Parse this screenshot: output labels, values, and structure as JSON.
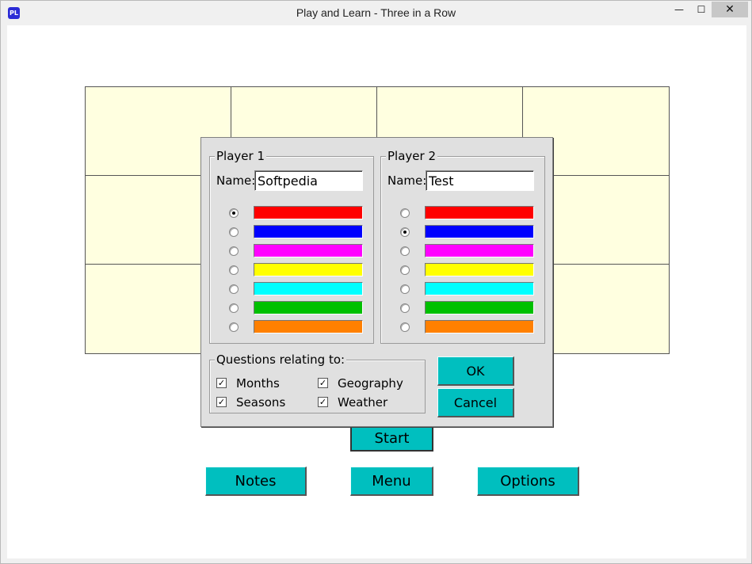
{
  "window": {
    "title": "Play and Learn - Three in a Row",
    "icon_text": "PL",
    "minimize_glyph": "—",
    "maximize_glyph": "☐",
    "close_glyph": "✕"
  },
  "buttons": {
    "start": "Start",
    "notes": "Notes",
    "menu": "Menu",
    "options": "Options"
  },
  "dialog": {
    "player1": {
      "label": "Player 1",
      "name_label": "Name:",
      "name_value": "Softpedia",
      "selected_color_index": 0
    },
    "player2": {
      "label": "Player 2",
      "name_label": "Name:",
      "name_value": "Test",
      "selected_color_index": 1
    },
    "colors": [
      "#ff0000",
      "#0000ff",
      "#ff00ff",
      "#ffff00",
      "#00ffff",
      "#00c000",
      "#ff8000"
    ],
    "questions": {
      "label": "Questions relating to:",
      "items": [
        {
          "label": "Months",
          "checked": true
        },
        {
          "label": "Geography",
          "checked": true
        },
        {
          "label": "Seasons",
          "checked": true
        },
        {
          "label": "Weather",
          "checked": true
        }
      ]
    },
    "ok_label": "OK",
    "cancel_label": "Cancel"
  },
  "colors": {
    "accent_teal": "#00bfbf",
    "board_fill": "#ffffe0"
  }
}
